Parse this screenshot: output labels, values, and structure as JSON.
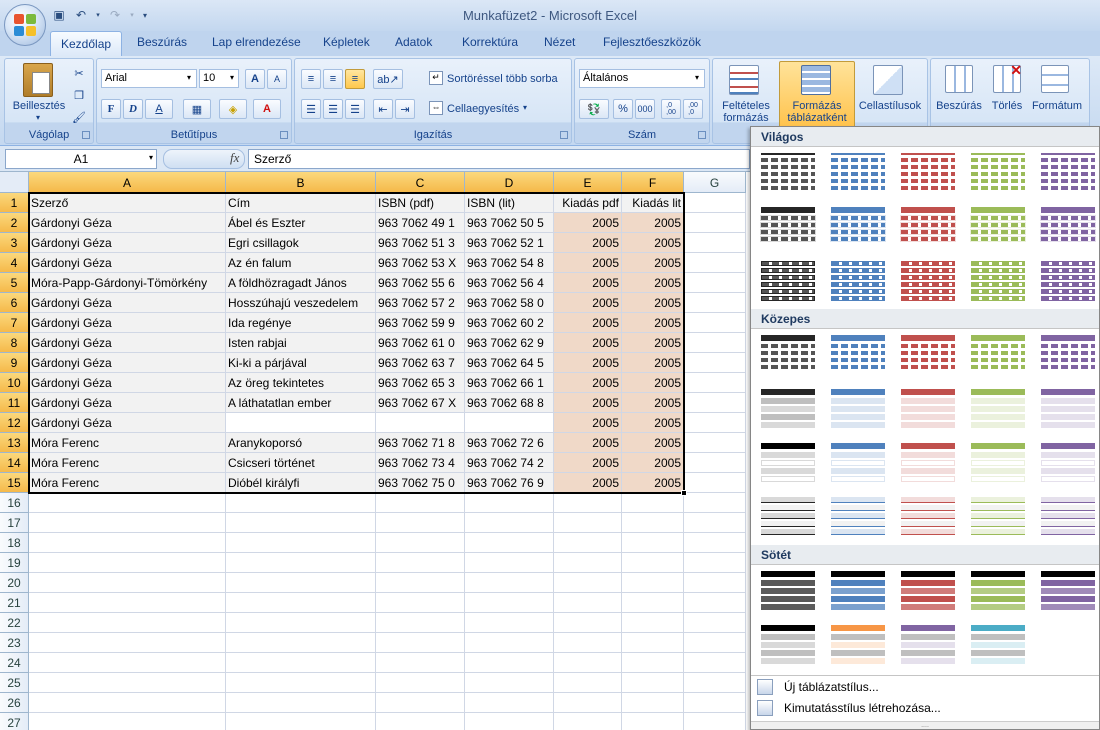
{
  "window": {
    "title": "Munkafüzet2 - Microsoft Excel"
  },
  "qat": {
    "save_icon": "save-icon",
    "undo_icon": "undo-icon",
    "redo_icon": "redo-icon"
  },
  "tabs": [
    {
      "label": "Kezdőlap",
      "active": true
    },
    {
      "label": "Beszúrás"
    },
    {
      "label": "Lap elrendezése"
    },
    {
      "label": "Képletek"
    },
    {
      "label": "Adatok"
    },
    {
      "label": "Korrektúra"
    },
    {
      "label": "Nézet"
    },
    {
      "label": "Fejlesztőeszközök"
    }
  ],
  "ribbon": {
    "clipboard": {
      "group": "Vágólap",
      "paste": "Beillesztés"
    },
    "font": {
      "group": "Betűtípus",
      "name": "Arial",
      "size": "10",
      "bold": "F",
      "italic": "D",
      "underline": "A",
      "grow": "A",
      "shrink": "A"
    },
    "alignment": {
      "group": "Igazítás",
      "wrap": "Sortöréssel több sorba",
      "merge": "Cellaegyesítés"
    },
    "number": {
      "group": "Szám",
      "format": "Általános",
      "percent": "%",
      "thousands": "000",
      "inc_dec": ",0\n,00",
      "dec_dec": ",00\n,0"
    },
    "styles": {
      "conditional": "Feltételes formázás",
      "format_table": "Formázás táblázatként",
      "cell_styles": "Cellastílusok"
    },
    "cells": {
      "insert": "Beszúrás",
      "delete": "Törlés",
      "format": "Formátum"
    }
  },
  "formula_bar": {
    "name_box": "A1",
    "fx": "fx",
    "value": "Szerző"
  },
  "sheet": {
    "columns": [
      "A",
      "B",
      "C",
      "D",
      "E",
      "F",
      "G"
    ],
    "rows": [
      [
        "Szerző",
        "Cím",
        "ISBN  (pdf)",
        "ISBN (lit)",
        "Kiadás pdf",
        "Kiadás lit"
      ],
      [
        "Gárdonyi Géza",
        "Ábel és Eszter",
        "963 7062 49 1",
        "963 7062 50 5",
        "2005",
        "2005"
      ],
      [
        "Gárdonyi Géza",
        "Egri csillagok",
        "963 7062 51 3",
        "963 7062 52 1",
        "2005",
        "2005"
      ],
      [
        "Gárdonyi Géza",
        "Az én falum",
        "963 7062 53 X",
        "963 7062 54 8",
        "2005",
        "2005"
      ],
      [
        "Móra-Papp-Gárdonyi-Tömörkény",
        "A földhözragadt János",
        "963 7062 55 6",
        "963 7062 56 4",
        "2005",
        "2005"
      ],
      [
        "Gárdonyi Géza",
        "Hosszúhajú veszedelem",
        "963 7062 57 2",
        "963 7062 58 0",
        "2005",
        "2005"
      ],
      [
        "Gárdonyi Géza",
        "Ida regénye",
        "963 7062 59 9",
        "963 7062 60 2",
        "2005",
        "2005"
      ],
      [
        "Gárdonyi Géza",
        "Isten rabjai",
        "963 7062 61 0",
        "963 7062 62 9",
        "2005",
        "2005"
      ],
      [
        "Gárdonyi Géza",
        "Ki-ki a párjával",
        "963 7062 63 7",
        "963 7062 64 5",
        "2005",
        "2005"
      ],
      [
        "Gárdonyi Géza",
        "Az öreg tekintetes",
        "963 7062 65 3",
        "963 7062 66 1",
        "2005",
        "2005"
      ],
      [
        "Gárdonyi Géza",
        "A láthatatlan ember",
        "963 7062 67 X",
        "963 7062 68 8",
        "2005",
        "2005"
      ],
      [
        "Gárdonyi Géza",
        "",
        "",
        "",
        "2005",
        "2005"
      ],
      [
        "Móra Ferenc",
        "Aranykoporsó",
        "963 7062 71 8",
        "963 7062 72 6",
        "2005",
        "2005"
      ],
      [
        "Móra Ferenc",
        "Csicseri történet",
        "963 7062 73 4",
        "963 7062 74 2",
        "2005",
        "2005"
      ],
      [
        "Móra Ferenc",
        "Dióbél királyfi",
        "963 7062 75 0",
        "963 7062 76 9",
        "2005",
        "2005"
      ]
    ],
    "row_numbers": [
      "1",
      "2",
      "3",
      "4",
      "5",
      "6",
      "7",
      "8",
      "9",
      "10",
      "11",
      "12",
      "13",
      "14",
      "15",
      "16",
      "17",
      "18",
      "19",
      "20",
      "21",
      "22",
      "23",
      "24",
      "25",
      "26",
      "27"
    ]
  },
  "gallery": {
    "sections": [
      "Világos",
      "Közepes",
      "Sötét"
    ],
    "colors": {
      "black": "#262626",
      "blue": "#4f81bd",
      "red": "#c0504d",
      "green": "#9bbb59",
      "purple": "#8064a2",
      "aqua": "#4bacc6",
      "orange": "#f79646"
    },
    "new_table_style": "Új táblázatstílus...",
    "new_pivot_style": "Kimutatásstílus létrehozása..."
  }
}
